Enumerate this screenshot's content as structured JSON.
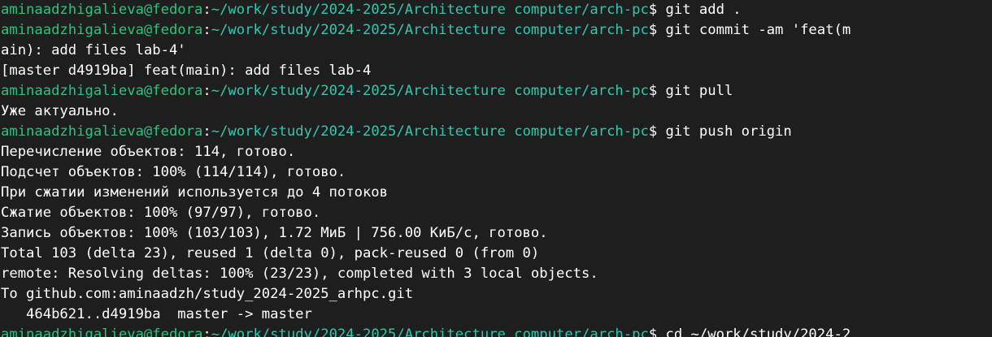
{
  "prompt": {
    "user_host": "aminaadzhigalieva@fedora",
    "colon": ":",
    "path": "~/work/study/2024-2025/Architecture computer/arch-pc",
    "dollar": "$ "
  },
  "lines": [
    {
      "type": "prompt",
      "cmd": "git add ."
    },
    {
      "type": "prompt",
      "cmd": "git commit -am 'feat(m"
    },
    {
      "type": "out",
      "text": "ain): add files lab-4'"
    },
    {
      "type": "out",
      "text": "[master d4919ba] feat(main): add files lab-4"
    },
    {
      "type": "prompt",
      "cmd": "git pull"
    },
    {
      "type": "out",
      "text": "Уже актуально."
    },
    {
      "type": "prompt",
      "cmd": "git push origin"
    },
    {
      "type": "out",
      "text": "Перечисление объектов: 114, готово."
    },
    {
      "type": "out",
      "text": "Подсчет объектов: 100% (114/114), готово."
    },
    {
      "type": "out",
      "text": "При сжатии изменений используется до 4 потоков"
    },
    {
      "type": "out",
      "text": "Сжатие объектов: 100% (97/97), готово."
    },
    {
      "type": "out",
      "text": "Запись объектов: 100% (103/103), 1.72 МиБ | 756.00 КиБ/с, готово."
    },
    {
      "type": "out",
      "text": "Total 103 (delta 23), reused 1 (delta 0), pack-reused 0 (from 0)"
    },
    {
      "type": "out",
      "text": "remote: Resolving deltas: 100% (23/23), completed with 3 local objects."
    },
    {
      "type": "out",
      "text": "To github.com:aminaadzh/study_2024-2025_arhpc.git"
    },
    {
      "type": "out",
      "text": "   464b621..d4919ba  master -> master"
    },
    {
      "type": "prompt",
      "cmd": "cd ~/work/study/2024-2"
    }
  ],
  "colors": {
    "background": "#1e1e1e",
    "prompt_user": "#2ec27e",
    "prompt_path": "#33c7b0",
    "text": "#ffffff"
  }
}
